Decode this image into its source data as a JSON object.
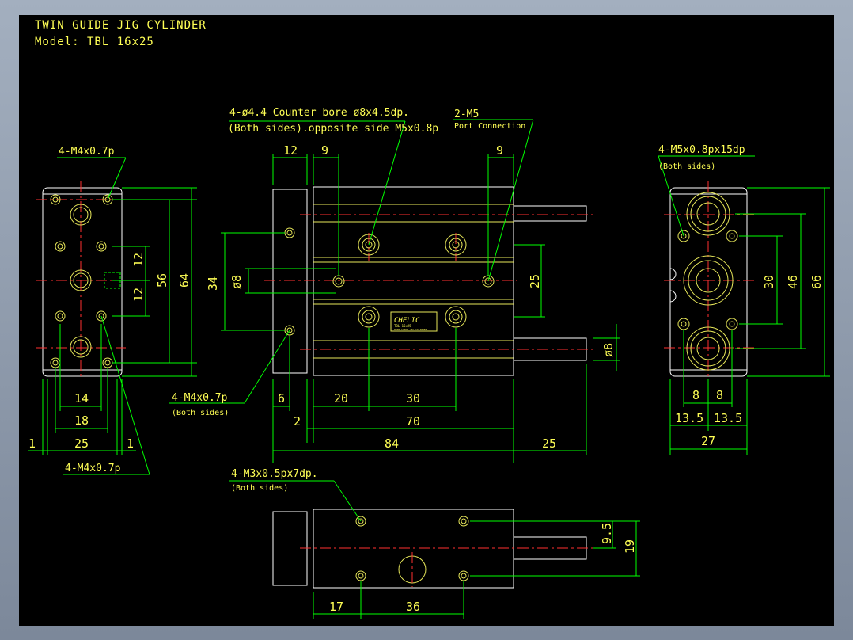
{
  "title": {
    "line1": "TWIN GUIDE JIG CYLINDER",
    "line2": "Model:  TBL 16x25"
  },
  "notes": {
    "top_a": "4-ø4.4  Counter bore  ø8x4.5dp.",
    "top_b": "(Both sides).opposite side  M5x0.8p",
    "port_a": "2-M5",
    "port_b": "Port Connection",
    "left_top": "4-M4x0.7p",
    "left_bottom": "4-M4x0.7p",
    "mid_a": "4-M4x0.7p",
    "mid_b": "(Both sides)",
    "right_a": "4-M5x0.8px15dp",
    "right_b": "(Both sides)",
    "bottom_a": "4-M3x0.5px7dp.",
    "bottom_b": "(Both sides)"
  },
  "label_plate": {
    "brand": "CHELIC",
    "line1": "TBL 16x25",
    "line2": "TWIN GUIDE JIG CYLINDER"
  },
  "dims": {
    "left": {
      "d12a": "12",
      "d12b": "12",
      "d56": "56",
      "d64": "64",
      "d14": "14",
      "d18": "18",
      "d25": "25",
      "d1a": "1",
      "d1b": "1"
    },
    "front": {
      "d12": "12",
      "d9a": "9",
      "d9b": "9",
      "d34": "34",
      "dphi8a": "ø8",
      "d25": "25",
      "dphi8b": "ø8",
      "d6": "6",
      "d20": "20",
      "d30": "30",
      "d2": "2",
      "d70": "70",
      "d84": "84",
      "d25b": "25"
    },
    "right": {
      "d30": "30",
      "d46": "46",
      "d66": "66",
      "d8a": "8",
      "d8b": "8",
      "d135a": "13.5",
      "d135b": "13.5",
      "d27": "27"
    },
    "bottom": {
      "d95": "9.5",
      "d19": "19",
      "d17": "17",
      "d36": "36"
    }
  },
  "colors": {
    "background": "#000000",
    "outline": "#ffffff",
    "dimension": "#00ff00",
    "centerline": "#ff3030",
    "text": "#ffff55"
  }
}
